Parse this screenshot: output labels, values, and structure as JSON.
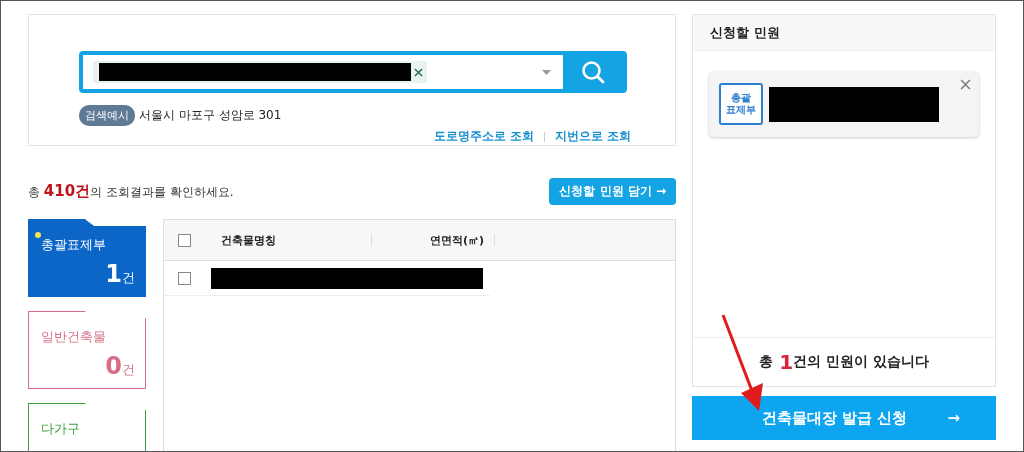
{
  "search": {
    "example_label": "검색예시",
    "example": "서울시 마포구 성암로 301",
    "links": [
      "도로명주소로 조회",
      "지번으로 조회"
    ]
  },
  "results": {
    "summary": "총 **410건**의 조회결과를 확인하세요.",
    "add_button": "신청할 민원 담기 →"
  },
  "categories": [
    {
      "label": "총괄표제부",
      "count": "1",
      "unit": "건",
      "selected": true,
      "color": "#0b66c8"
    },
    {
      "label": "일반건축물",
      "count": "0",
      "unit": "건",
      "selected": false,
      "color": "#d66f86"
    },
    {
      "label": "다가구",
      "selected": false,
      "color": "#3a9e3a"
    }
  ],
  "table": {
    "columns": [
      "건축물명칭",
      "연면적(㎡)"
    ],
    "header_checked": false,
    "rows": [
      {
        "checked": false
      }
    ]
  },
  "cart": {
    "title": "신청할 민원",
    "items": [
      {
        "badge": [
          "총괄",
          "표제부"
        ]
      }
    ],
    "summary": "총 **1**건의 민원이 있습니다",
    "submit": "건축물대장 발급 신청",
    "submit_arrow": "→"
  }
}
